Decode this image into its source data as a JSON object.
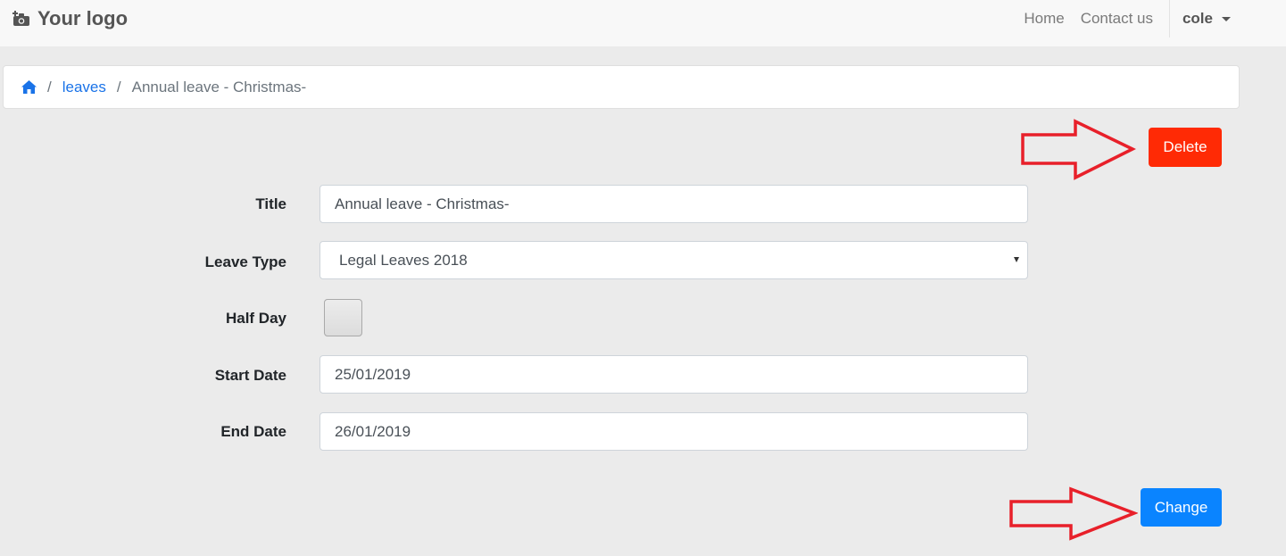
{
  "navbar": {
    "brand": "Your logo",
    "brand_icon": "camera-plus-icon",
    "links": [
      "Home",
      "Contact us"
    ],
    "user": "cole"
  },
  "breadcrumb": {
    "home_icon": "home-icon",
    "parent": "leaves",
    "current": "Annual leave - Christmas-"
  },
  "actions": {
    "delete": "Delete",
    "change": "Change",
    "delete_color": "#ff2a05",
    "change_color": "#0a84ff",
    "annotation_color": "#e8202a"
  },
  "form": {
    "title_label": "Title",
    "title_value": "Annual leave - Christmas-",
    "leave_type_label": "Leave Type",
    "leave_type_value": "Legal Leaves 2018",
    "half_day_label": "Half Day",
    "half_day_checked": false,
    "start_date_label": "Start Date",
    "start_date_value": "25/01/2019",
    "end_date_label": "End Date",
    "end_date_value": "26/01/2019"
  }
}
